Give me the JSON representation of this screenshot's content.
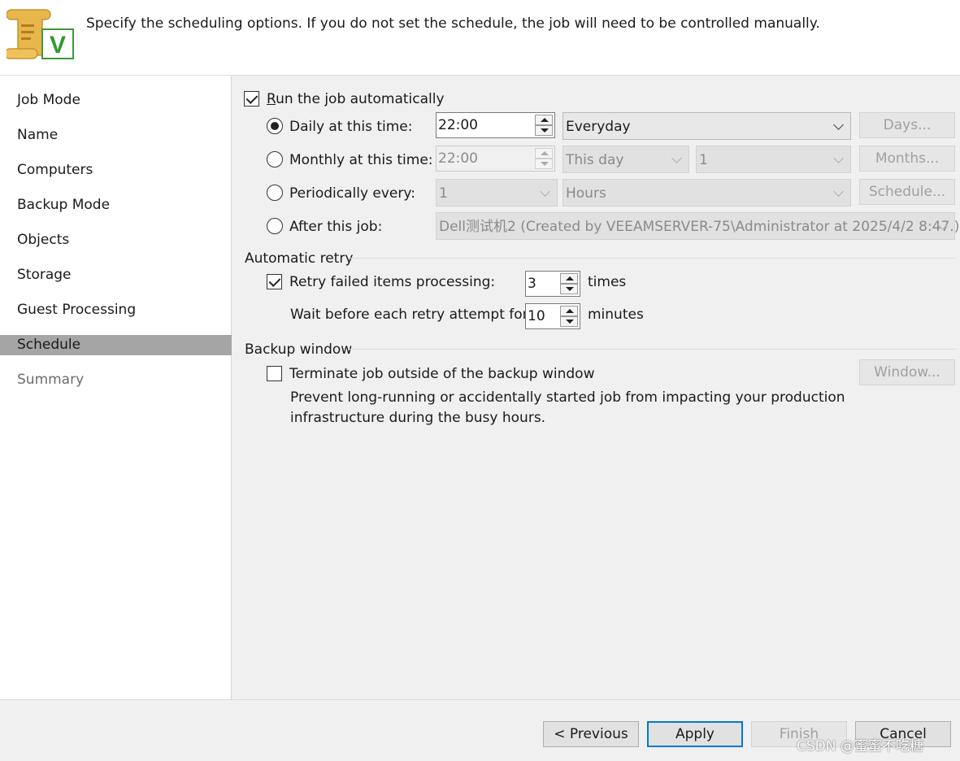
{
  "header": {
    "description": "Specify the scheduling options. If you do not set the schedule, the job will need to be controlled manually.",
    "logo_icon": "veeam-job-scroll-icon",
    "logo_letter": "V"
  },
  "sidebar": {
    "items": [
      {
        "label": "Job Mode",
        "state": "normal"
      },
      {
        "label": "Name",
        "state": "normal"
      },
      {
        "label": "Computers",
        "state": "normal"
      },
      {
        "label": "Backup Mode",
        "state": "normal"
      },
      {
        "label": "Objects",
        "state": "normal"
      },
      {
        "label": "Storage",
        "state": "normal"
      },
      {
        "label": "Guest Processing",
        "state": "normal"
      },
      {
        "label": "Schedule",
        "state": "active"
      },
      {
        "label": "Summary",
        "state": "disabled"
      }
    ]
  },
  "schedule": {
    "run_auto": {
      "label": "Run the job automatically",
      "checked": true
    },
    "daily": {
      "label": "Daily at this time:",
      "selected": true,
      "time": "22:00",
      "frequency": "Everyday",
      "button": "Days..."
    },
    "monthly": {
      "label": "Monthly at this time:",
      "selected": false,
      "time": "22:00",
      "day_option": "This day",
      "day_number": "1",
      "button": "Months..."
    },
    "periodically": {
      "label": "Periodically every:",
      "selected": false,
      "value": "1",
      "unit": "Hours",
      "button": "Schedule..."
    },
    "after_job": {
      "label": "After this job:",
      "selected": false,
      "job": "Dell测试机2 (Created by VEEAMSERVER-75\\Administrator at 2025/4/2 8:47.)"
    }
  },
  "retry": {
    "group_title": "Automatic retry",
    "retry_label": "Retry failed items processing:",
    "retry_checked": true,
    "retry_count": "3",
    "retry_unit": "times",
    "wait_label": "Wait before each retry attempt for:",
    "wait_value": "10",
    "wait_unit": "minutes"
  },
  "backup_window": {
    "group_title": "Backup window",
    "terminate_label": "Terminate job outside of the backup window",
    "terminate_checked": false,
    "description_line1": "Prevent long-running or accidentally started job from impacting your production",
    "description_line2": "infrastructure during the busy hours.",
    "button": "Window..."
  },
  "footer": {
    "previous": "< Previous",
    "apply": "Apply",
    "finish": "Finish",
    "cancel": "Cancel"
  },
  "watermark": "CSDN @蜜蜜不吃糖",
  "colors": {
    "accent": "#0078d7",
    "active_nav": "#a5a5a5",
    "logo_green": "#2e9b2e",
    "logo_gold": "#d9a441"
  }
}
